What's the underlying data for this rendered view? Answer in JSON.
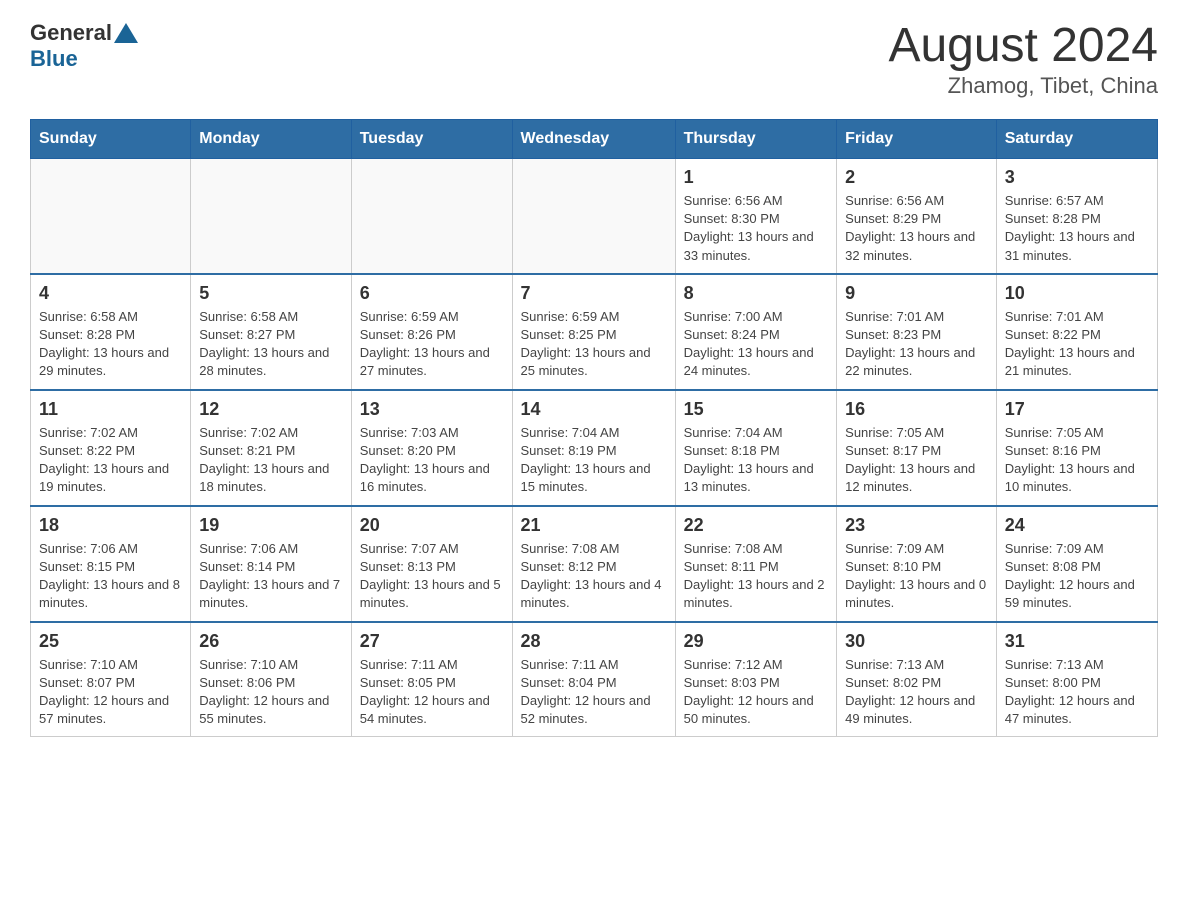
{
  "header": {
    "logo_general": "General",
    "logo_blue": "Blue",
    "title": "August 2024",
    "subtitle": "Zhamog, Tibet, China"
  },
  "days_of_week": [
    "Sunday",
    "Monday",
    "Tuesday",
    "Wednesday",
    "Thursday",
    "Friday",
    "Saturday"
  ],
  "weeks": [
    [
      {
        "day": "",
        "detail": ""
      },
      {
        "day": "",
        "detail": ""
      },
      {
        "day": "",
        "detail": ""
      },
      {
        "day": "",
        "detail": ""
      },
      {
        "day": "1",
        "detail": "Sunrise: 6:56 AM\nSunset: 8:30 PM\nDaylight: 13 hours and 33 minutes."
      },
      {
        "day": "2",
        "detail": "Sunrise: 6:56 AM\nSunset: 8:29 PM\nDaylight: 13 hours and 32 minutes."
      },
      {
        "day": "3",
        "detail": "Sunrise: 6:57 AM\nSunset: 8:28 PM\nDaylight: 13 hours and 31 minutes."
      }
    ],
    [
      {
        "day": "4",
        "detail": "Sunrise: 6:58 AM\nSunset: 8:28 PM\nDaylight: 13 hours and 29 minutes."
      },
      {
        "day": "5",
        "detail": "Sunrise: 6:58 AM\nSunset: 8:27 PM\nDaylight: 13 hours and 28 minutes."
      },
      {
        "day": "6",
        "detail": "Sunrise: 6:59 AM\nSunset: 8:26 PM\nDaylight: 13 hours and 27 minutes."
      },
      {
        "day": "7",
        "detail": "Sunrise: 6:59 AM\nSunset: 8:25 PM\nDaylight: 13 hours and 25 minutes."
      },
      {
        "day": "8",
        "detail": "Sunrise: 7:00 AM\nSunset: 8:24 PM\nDaylight: 13 hours and 24 minutes."
      },
      {
        "day": "9",
        "detail": "Sunrise: 7:01 AM\nSunset: 8:23 PM\nDaylight: 13 hours and 22 minutes."
      },
      {
        "day": "10",
        "detail": "Sunrise: 7:01 AM\nSunset: 8:22 PM\nDaylight: 13 hours and 21 minutes."
      }
    ],
    [
      {
        "day": "11",
        "detail": "Sunrise: 7:02 AM\nSunset: 8:22 PM\nDaylight: 13 hours and 19 minutes."
      },
      {
        "day": "12",
        "detail": "Sunrise: 7:02 AM\nSunset: 8:21 PM\nDaylight: 13 hours and 18 minutes."
      },
      {
        "day": "13",
        "detail": "Sunrise: 7:03 AM\nSunset: 8:20 PM\nDaylight: 13 hours and 16 minutes."
      },
      {
        "day": "14",
        "detail": "Sunrise: 7:04 AM\nSunset: 8:19 PM\nDaylight: 13 hours and 15 minutes."
      },
      {
        "day": "15",
        "detail": "Sunrise: 7:04 AM\nSunset: 8:18 PM\nDaylight: 13 hours and 13 minutes."
      },
      {
        "day": "16",
        "detail": "Sunrise: 7:05 AM\nSunset: 8:17 PM\nDaylight: 13 hours and 12 minutes."
      },
      {
        "day": "17",
        "detail": "Sunrise: 7:05 AM\nSunset: 8:16 PM\nDaylight: 13 hours and 10 minutes."
      }
    ],
    [
      {
        "day": "18",
        "detail": "Sunrise: 7:06 AM\nSunset: 8:15 PM\nDaylight: 13 hours and 8 minutes."
      },
      {
        "day": "19",
        "detail": "Sunrise: 7:06 AM\nSunset: 8:14 PM\nDaylight: 13 hours and 7 minutes."
      },
      {
        "day": "20",
        "detail": "Sunrise: 7:07 AM\nSunset: 8:13 PM\nDaylight: 13 hours and 5 minutes."
      },
      {
        "day": "21",
        "detail": "Sunrise: 7:08 AM\nSunset: 8:12 PM\nDaylight: 13 hours and 4 minutes."
      },
      {
        "day": "22",
        "detail": "Sunrise: 7:08 AM\nSunset: 8:11 PM\nDaylight: 13 hours and 2 minutes."
      },
      {
        "day": "23",
        "detail": "Sunrise: 7:09 AM\nSunset: 8:10 PM\nDaylight: 13 hours and 0 minutes."
      },
      {
        "day": "24",
        "detail": "Sunrise: 7:09 AM\nSunset: 8:08 PM\nDaylight: 12 hours and 59 minutes."
      }
    ],
    [
      {
        "day": "25",
        "detail": "Sunrise: 7:10 AM\nSunset: 8:07 PM\nDaylight: 12 hours and 57 minutes."
      },
      {
        "day": "26",
        "detail": "Sunrise: 7:10 AM\nSunset: 8:06 PM\nDaylight: 12 hours and 55 minutes."
      },
      {
        "day": "27",
        "detail": "Sunrise: 7:11 AM\nSunset: 8:05 PM\nDaylight: 12 hours and 54 minutes."
      },
      {
        "day": "28",
        "detail": "Sunrise: 7:11 AM\nSunset: 8:04 PM\nDaylight: 12 hours and 52 minutes."
      },
      {
        "day": "29",
        "detail": "Sunrise: 7:12 AM\nSunset: 8:03 PM\nDaylight: 12 hours and 50 minutes."
      },
      {
        "day": "30",
        "detail": "Sunrise: 7:13 AM\nSunset: 8:02 PM\nDaylight: 12 hours and 49 minutes."
      },
      {
        "day": "31",
        "detail": "Sunrise: 7:13 AM\nSunset: 8:00 PM\nDaylight: 12 hours and 47 minutes."
      }
    ]
  ]
}
